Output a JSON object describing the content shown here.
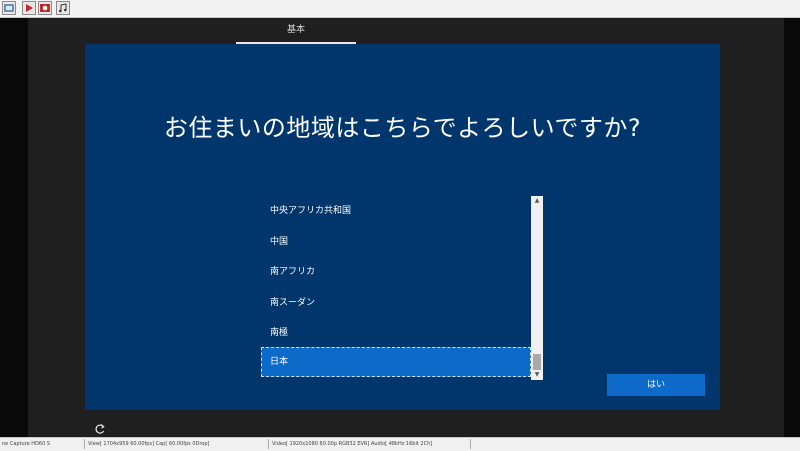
{
  "status_bar": {
    "app": "ne Capture HD60 S",
    "view": "View[ 1704x959 60.00fps]  Cap[ 60.00fps 0Drop]",
    "video": "Video[ 1920x1080 60.00p  RGB32 EVR]  Audio[ 48kHz 16bit 2Ch]"
  },
  "oobe": {
    "tab": "基本",
    "heading": "お住まいの地域はこちらでよろしいですか?",
    "regions": [
      {
        "label": "中央アフリカ共和国",
        "selected": false
      },
      {
        "label": "中国",
        "selected": false
      },
      {
        "label": "南アフリカ",
        "selected": false
      },
      {
        "label": "南スーダン",
        "selected": false
      },
      {
        "label": "南極",
        "selected": false
      },
      {
        "label": "日本",
        "selected": true
      }
    ],
    "yes_button": "はい"
  },
  "toolbar_icons": [
    "capture-menu-icon",
    "play-icon",
    "record-icon",
    "audio-icon"
  ],
  "colors": {
    "panel": "#00366b",
    "accent": "#0d6ac8"
  }
}
